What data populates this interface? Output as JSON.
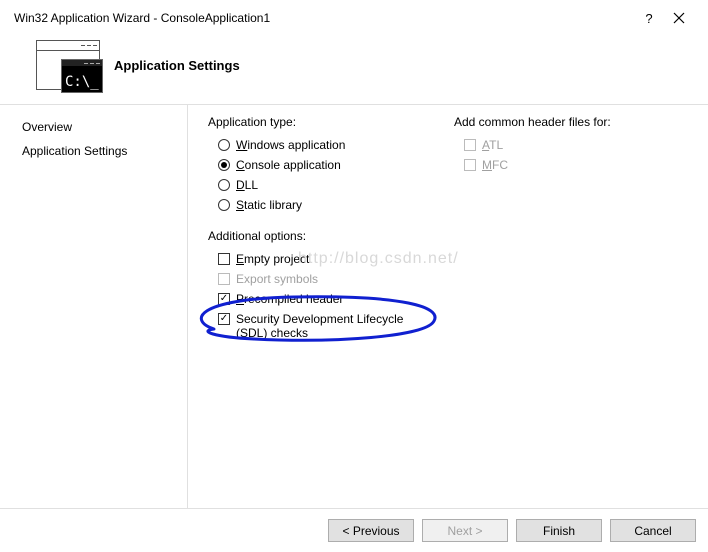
{
  "window": {
    "title": "Win32 Application Wizard - ConsoleApplication1",
    "help_symbol": "?"
  },
  "header": {
    "title": "Application Settings",
    "console_text": "C:\\_"
  },
  "sidebar": {
    "items": [
      {
        "label": "Overview"
      },
      {
        "label": "Application Settings"
      }
    ]
  },
  "main": {
    "app_type_label": "Application type:",
    "app_types": {
      "windows": "indows application",
      "windows_accel": "W",
      "console": "onsole application",
      "console_accel": "C",
      "dll": "LL",
      "dll_accel": "D",
      "static": "tatic library",
      "static_accel": "S"
    },
    "additional_label": "Additional options:",
    "additional": {
      "empty": "mpty project",
      "empty_accel": "E",
      "export": "xport symbols",
      "export_accel": "E",
      "precompiled": "recompiled header",
      "precompiled_accel": "P",
      "sdl": "Security Development Lifecycle (SDL) checks"
    },
    "common_header_label": "Add common header files for:",
    "common": {
      "atl": "TL",
      "atl_accel": "A",
      "mfc": "FC",
      "mfc_accel": "M"
    }
  },
  "watermark": "http://blog.csdn.net/",
  "footer": {
    "previous": "< Previous",
    "next": "Next >",
    "finish": "Finish",
    "cancel": "Cancel"
  }
}
